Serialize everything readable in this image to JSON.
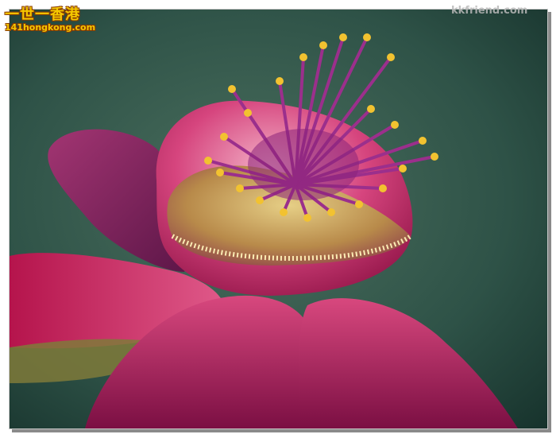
{
  "watermark": {
    "brand_cn": "一世一香港",
    "brand_url": "141hongkong.com",
    "site_right": "kkfriend.com"
  },
  "photo": {
    "subject": "flower-photo",
    "colors": {
      "background_dark": "#1c3a33",
      "background_mid": "#3b6356",
      "petal_magenta": "#c2185b",
      "petal_deep": "#7a1040",
      "stamen_purple": "#9a2f8a",
      "anther_yellow": "#f2c230"
    }
  }
}
